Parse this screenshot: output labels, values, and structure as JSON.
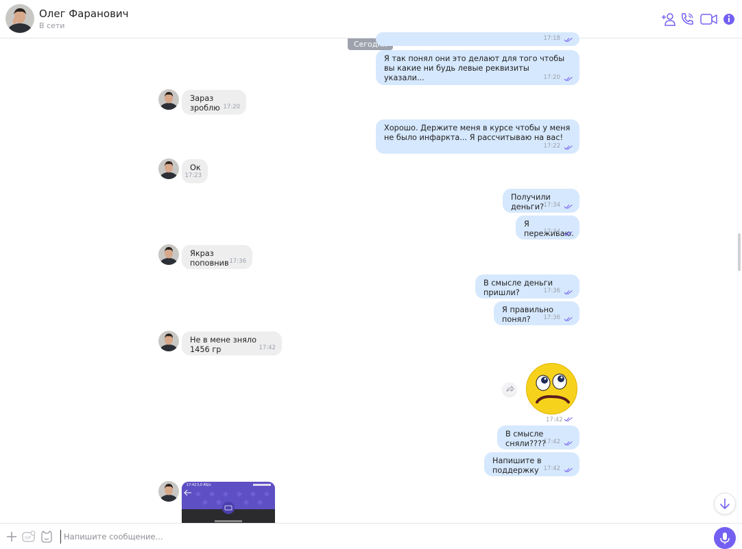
{
  "header": {
    "name": "Олег Фаранович",
    "status": "В сети"
  },
  "date_separator": "Сегодня",
  "messages": [
    {
      "dir": "out",
      "text": "",
      "time": "17:18"
    },
    {
      "dir": "out",
      "text": "Я так понял они это делают для того чтобы вы какие ни будь левые реквизиты указали...",
      "time": "17:20"
    },
    {
      "dir": "in",
      "text": "Зараз зроблю",
      "time": "17:20"
    },
    {
      "dir": "out",
      "text": "Хорошо. Держите меня в курсе чтобы у меня не было инфаркта... Я рассчитываю на вас!",
      "time": "17:22"
    },
    {
      "dir": "in",
      "text": "Ок",
      "time": "17:23"
    },
    {
      "dir": "out",
      "text": "Получили деньги?",
      "time": "17:34"
    },
    {
      "dir": "out",
      "text": "Я переживаю.",
      "time": "17:34"
    },
    {
      "dir": "in",
      "text": "Якраз поповнив",
      "time": "17:36"
    },
    {
      "dir": "out",
      "text": "В смысле деньги пришли?",
      "time": "17:36"
    },
    {
      "dir": "out",
      "text": "Я правильно понял?",
      "time": "17:36"
    },
    {
      "dir": "in",
      "text": "Не в мене зняло 1456 гр",
      "time": "17:42"
    },
    {
      "dir": "out",
      "text": "",
      "time": "17:42",
      "sticker": "confused-face"
    },
    {
      "dir": "out",
      "text": "В смысле сняли????",
      "time": "17:42"
    },
    {
      "dir": "out",
      "text": "Напишите в поддержку",
      "time": "17:42"
    }
  ],
  "image_message": {
    "status_time": "17:42",
    "status_speed": "3,0 КБ/с"
  },
  "composer": {
    "placeholder": "Напишите сообщение..."
  },
  "icons": {
    "header": [
      "add-participant-icon",
      "phone-icon",
      "video-icon",
      "info-icon"
    ],
    "composer": [
      "plus-icon",
      "gif-icon",
      "sticker-icon",
      "microphone-icon"
    ]
  },
  "colors": {
    "accent": "#7360f2",
    "outgoing_bubble": "#d6e8fd",
    "incoming_bubble": "#eeeeef",
    "date_pill": "#9ea2ad"
  }
}
